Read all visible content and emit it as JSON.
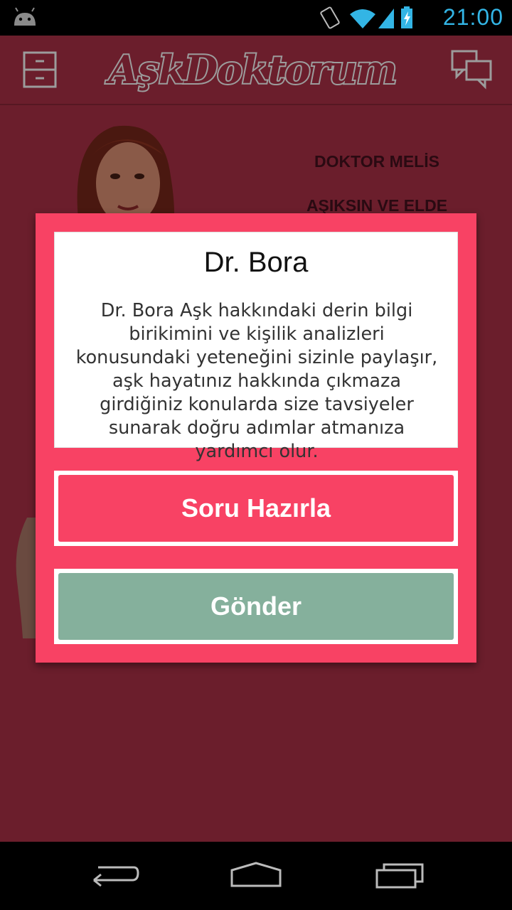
{
  "status_bar": {
    "time": "21:00",
    "icons": [
      "android-icon",
      "rotate-icon",
      "wifi-icon",
      "signal-icon",
      "battery-charging-icon"
    ],
    "accent_color": "#33b5e5"
  },
  "app_bar": {
    "logo_text": "AşkDoktorum",
    "menu_icon": "drawer-icon",
    "chat_icon": "chat-icon",
    "bg_color": "#6b1e2c"
  },
  "background": {
    "doctor_name": "DOKTOR MELİS",
    "partial_text": "AŞIKSIN VE ELDE"
  },
  "dialog": {
    "title": "Dr. Bora",
    "description": "Dr. Bora Aşk hakkındaki derin bilgi birikimini ve kişilik analizleri konusundaki yeteneğini sizinle paylaşır, aşk hayatınız hakkında çıkmaza girdiğiniz konularda size tavsiyeler sunarak doğru adımlar atmanıza yardımcı olur.",
    "primary_button": "Soru Hazırla",
    "secondary_button": "Gönder",
    "accent_color": "#f84264",
    "secondary_color": "#85b09c"
  },
  "nav_bar": {
    "back_icon": "back-icon",
    "home_icon": "home-icon",
    "recents_icon": "recents-icon"
  }
}
